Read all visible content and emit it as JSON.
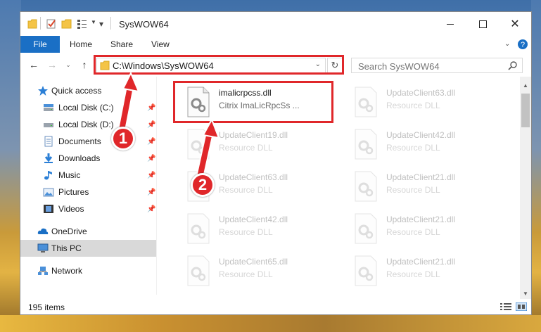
{
  "window": {
    "title": "SysWOW64"
  },
  "ribbon": {
    "tabs": [
      "File",
      "Home",
      "Share",
      "View"
    ]
  },
  "address_bar": {
    "path": "C:\\Windows\\SysWOW64"
  },
  "search": {
    "placeholder": "Search SysWOW64"
  },
  "nav": {
    "quick_access": "Quick access",
    "items": [
      {
        "label": "Local Disk (C:)",
        "icon": "drive-icon",
        "pinned": true
      },
      {
        "label": "Local Disk (D:)",
        "icon": "drive-icon",
        "pinned": true
      },
      {
        "label": "Documents",
        "icon": "documents-icon",
        "pinned": true
      },
      {
        "label": "Downloads",
        "icon": "downloads-icon",
        "pinned": true
      },
      {
        "label": "Music",
        "icon": "music-icon",
        "pinned": true
      },
      {
        "label": "Pictures",
        "icon": "pictures-icon",
        "pinned": true
      },
      {
        "label": "Videos",
        "icon": "videos-icon",
        "pinned": true
      }
    ],
    "onedrive": "OneDrive",
    "this_pc": "This PC",
    "network": "Network"
  },
  "files": {
    "highlighted": {
      "name": "imalicrpcss.dll",
      "desc": "Citrix ImaLicRpcSs ..."
    },
    "col1": [
      {
        "name": "UpdateClient19.dll",
        "desc": "Resource DLL"
      },
      {
        "name": "UpdateClient63.dll",
        "desc": "Resource DLL"
      },
      {
        "name": "UpdateClient42.dll",
        "desc": "Resource DLL"
      },
      {
        "name": "UpdateClient65.dll",
        "desc": "Resource DLL"
      }
    ],
    "col2": [
      {
        "name": "UpdateClient63.dll",
        "desc": "Resource DLL"
      },
      {
        "name": "UpdateClient42.dll",
        "desc": "Resource DLL"
      },
      {
        "name": "UpdateClient21.dll",
        "desc": "Resource DLL"
      },
      {
        "name": "UpdateClient21.dll",
        "desc": "Resource DLL"
      },
      {
        "name": "UpdateClient21.dll",
        "desc": "Resource DLL"
      }
    ]
  },
  "status": {
    "item_count": "195 items"
  },
  "callouts": {
    "one": "1",
    "two": "2"
  },
  "colors": {
    "accent": "#1a6fc5",
    "highlight": "#e0272a",
    "selected_nav": "#d9d9d9"
  }
}
